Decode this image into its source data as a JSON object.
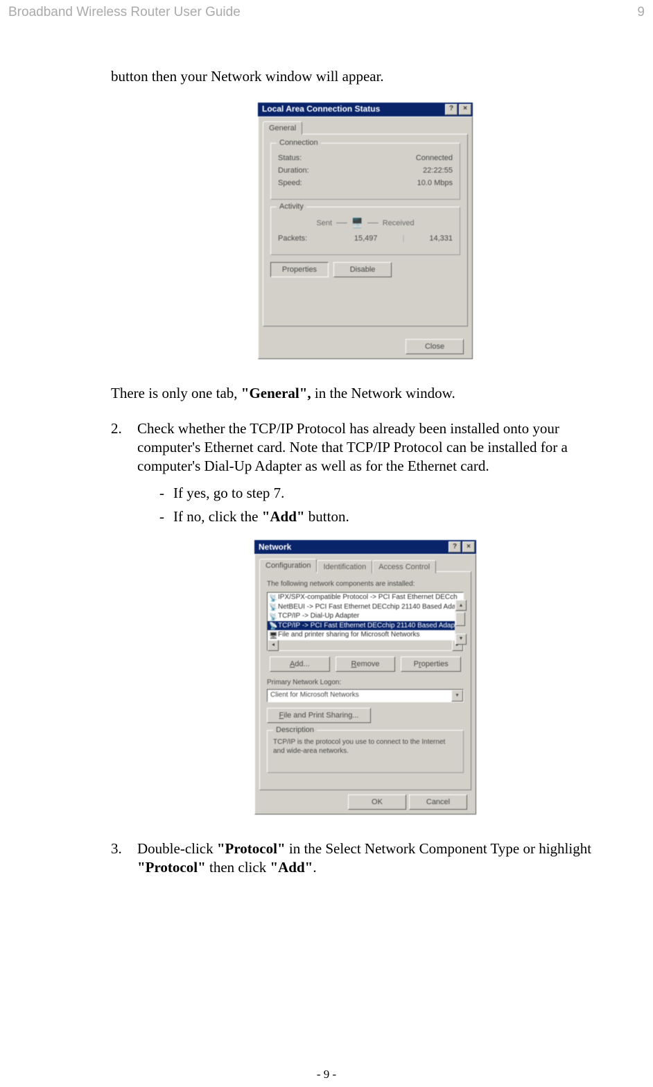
{
  "header": {
    "title": "Broadband Wireless Router User Guide",
    "page_number_top": "9"
  },
  "body": {
    "intro_fragment": "button then your Network window will appear.",
    "dialog1": {
      "title": "Local Area Connection Status",
      "help_btn": "?",
      "close_btn": "×",
      "tab_general": "General",
      "group_connection": "Connection",
      "status_label": "Status:",
      "status_value": "Connected",
      "duration_label": "Duration:",
      "duration_value": "22:22:55",
      "speed_label": "Speed:",
      "speed_value": "10.0 Mbps",
      "group_activity": "Activity",
      "sent_label": "Sent",
      "received_label": "Received",
      "packets_label": "Packets:",
      "packets_sent": "15,497",
      "packets_received": "14,331",
      "btn_properties": "Properties",
      "btn_disable": "Disable",
      "btn_close": "Close"
    },
    "after_dialog1_pre": "There is only one tab, ",
    "after_dialog1_bold": "\"General\",",
    "after_dialog1_post": " in the Network window.",
    "step2": {
      "marker": "2.",
      "text": "Check whether the TCP/IP Protocol has already been installed onto your computer's Ethernet card. Note that TCP/IP Protocol can be installed for a computer's Dial-Up Adapter as well as for the Ethernet card.",
      "bullet_marker": "-",
      "bullet_a": "If yes, go to step 7.",
      "bullet_b_pre": "If no, click the ",
      "bullet_b_bold": "\"Add\"",
      "bullet_b_post": " button."
    },
    "dialog2": {
      "title": "Network",
      "help_btn": "?",
      "close_btn": "×",
      "tab_configuration": "Configuration",
      "tab_identification": "Identification",
      "tab_access": "Access Control",
      "list_label": "The following network components are installed:",
      "items": [
        "IPX/SPX-compatible Protocol -> PCI Fast Ethernet DECch",
        "NetBEUI -> PCI Fast Ethernet DECchip 21140 Based Ada",
        "TCP/IP -> Dial-Up Adapter",
        "TCP/IP -> PCI Fast Ethernet DECchip 21140 Based Adap",
        "File and printer sharing for Microsoft Networks"
      ],
      "selected_index": 3,
      "btn_add": "Add...",
      "btn_remove": "Remove",
      "btn_properties": "Properties",
      "primary_logon_label": "Primary Network Logon:",
      "primary_logon_value": "Client for Microsoft Networks",
      "btn_file_print": "File and Print Sharing...",
      "desc_label": "Description",
      "desc_text": "TCP/IP is the protocol you use to connect to the Internet and wide-area networks.",
      "btn_ok": "OK",
      "btn_cancel": "Cancel"
    },
    "step3": {
      "marker": "3.",
      "pre1": "Double-click ",
      "bold1": "\"Protocol\"",
      "mid1": " in the Select Network Component Type or highlight ",
      "bold2": "\"Protocol\"",
      "mid2": " then click ",
      "bold3": "\"Add\"",
      "post": "."
    }
  },
  "footer": {
    "page_marker": "- 9 -"
  }
}
